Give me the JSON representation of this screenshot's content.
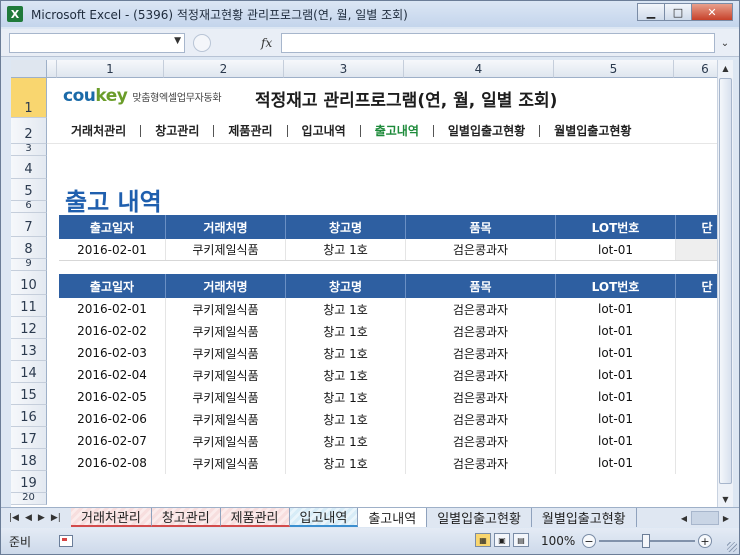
{
  "window": {
    "title": "Microsoft Excel - (5396) 적정재고현황 관리프로그램(연, 월, 일별 조회)",
    "app_icon": "excel-icon",
    "minimize": "▁",
    "maximize": "□",
    "close": "✕"
  },
  "formula_bar": {
    "name_box": "",
    "fx": "fx",
    "formula": ""
  },
  "columns": [
    "1",
    "2",
    "3",
    "4",
    "5",
    "6"
  ],
  "rows": [
    "1",
    "2",
    "3",
    "4",
    "5",
    "6",
    "7",
    "8",
    "9",
    "10",
    "11",
    "12",
    "13",
    "14",
    "15",
    "16",
    "17",
    "18",
    "19",
    "20"
  ],
  "header": {
    "logo_main": "cou",
    "logo_accent": "key",
    "logo_sub": "맞춤형엑셀업무자동화",
    "program_title": "적정재고 관리프로그램(연, 월, 일별 조회)"
  },
  "nav": [
    {
      "label": "거래처관리",
      "active": false
    },
    {
      "label": "창고관리",
      "active": false
    },
    {
      "label": "제품관리",
      "active": false
    },
    {
      "label": "입고내역",
      "active": false
    },
    {
      "label": "출고내역",
      "active": true
    },
    {
      "label": "일별입출고현황",
      "active": false
    },
    {
      "label": "월별입출고현황",
      "active": false
    }
  ],
  "page_heading": "출고 내역",
  "table_columns": [
    "출고일자",
    "거래처명",
    "창고명",
    "품목",
    "LOT번호",
    "단"
  ],
  "input_row": [
    "2016-02-01",
    "쿠키제일식품",
    "창고 1호",
    "검은콩과자",
    "lot-01",
    ""
  ],
  "list_rows": [
    [
      "2016-02-01",
      "쿠키제일식품",
      "창고 1호",
      "검은콩과자",
      "lot-01",
      ""
    ],
    [
      "2016-02-02",
      "쿠키제일식품",
      "창고 1호",
      "검은콩과자",
      "lot-01",
      ""
    ],
    [
      "2016-02-03",
      "쿠키제일식품",
      "창고 1호",
      "검은콩과자",
      "lot-01",
      ""
    ],
    [
      "2016-02-04",
      "쿠키제일식품",
      "창고 1호",
      "검은콩과자",
      "lot-01",
      ""
    ],
    [
      "2016-02-05",
      "쿠키제일식품",
      "창고 1호",
      "검은콩과자",
      "lot-01",
      ""
    ],
    [
      "2016-02-06",
      "쿠키제일식품",
      "창고 1호",
      "검은콩과자",
      "lot-01",
      ""
    ],
    [
      "2016-02-07",
      "쿠키제일식품",
      "창고 1호",
      "검은콩과자",
      "lot-01",
      ""
    ],
    [
      "2016-02-08",
      "쿠키제일식품",
      "창고 1호",
      "검은콩과자",
      "lot-01",
      ""
    ]
  ],
  "sheet_tabs": [
    {
      "label": "거래처관리",
      "style": "red"
    },
    {
      "label": "창고관리",
      "style": "red"
    },
    {
      "label": "제품관리",
      "style": "red"
    },
    {
      "label": "입고내역",
      "style": "blue"
    },
    {
      "label": "출고내역",
      "style": "active"
    },
    {
      "label": "일별입출고현황",
      "style": "plain"
    },
    {
      "label": "월별입출고현황",
      "style": "plain"
    }
  ],
  "status": {
    "ready": "준비",
    "zoom": "100%",
    "zoom_minus": "−",
    "zoom_plus": "+"
  },
  "colors": {
    "table_header": "#2e5fa1",
    "heading": "#1f5fae",
    "active_nav": "#1d8a3a",
    "selected_row": "#f9d66f"
  }
}
